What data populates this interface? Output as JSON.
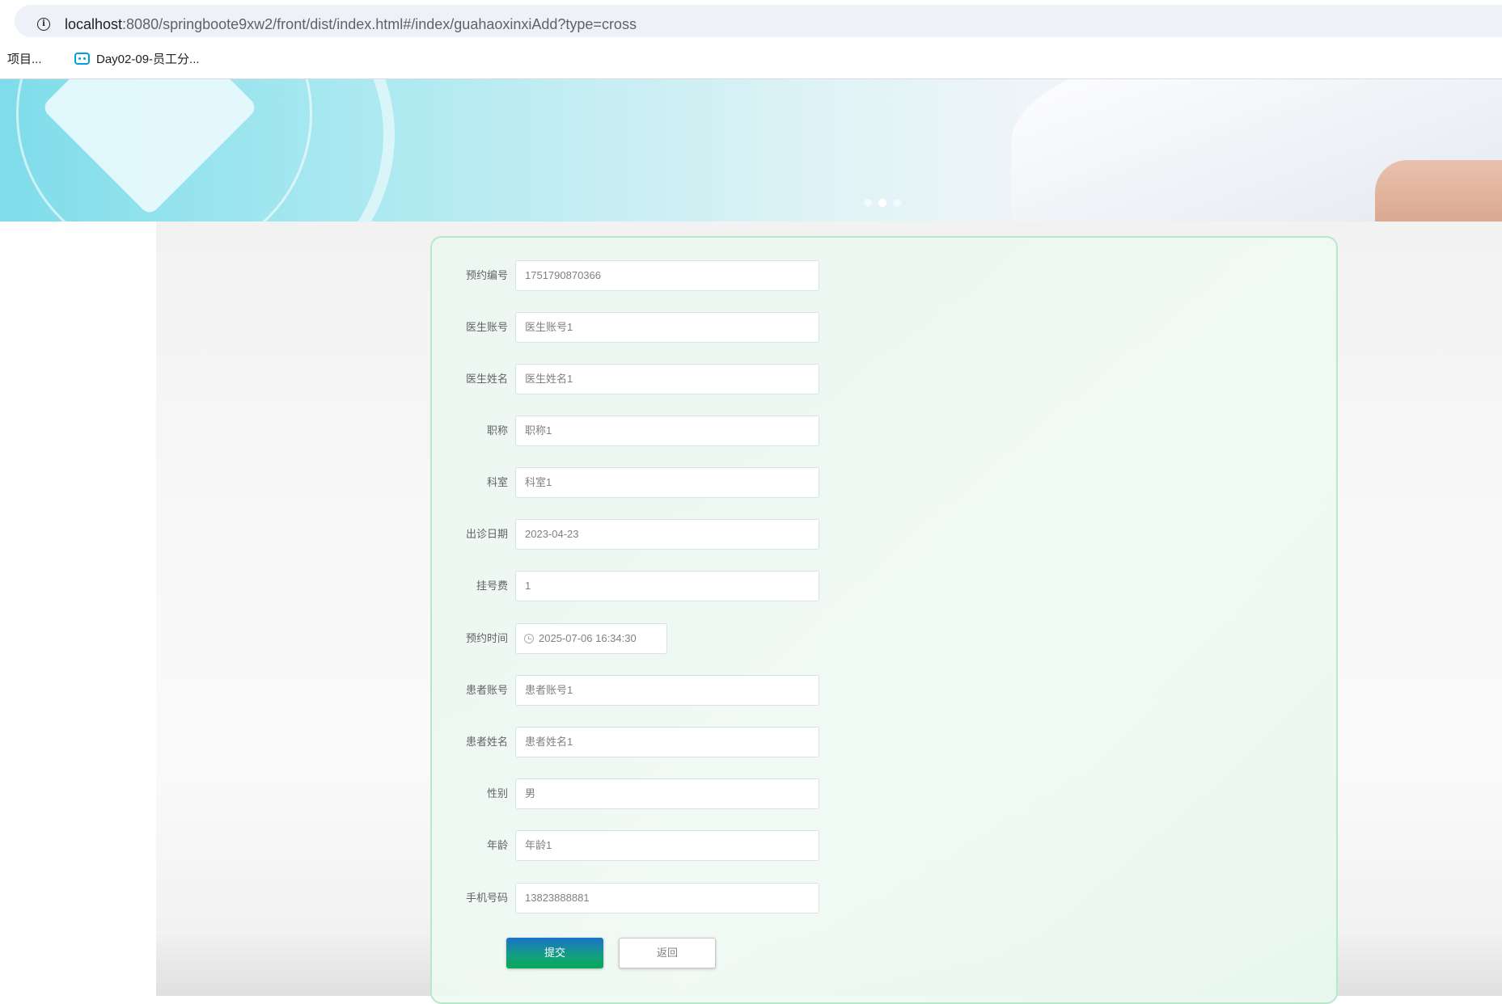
{
  "browser": {
    "url_host": "localhost",
    "url_rest": ":8080/springboote9xw2/front/dist/index.html#/index/guahaoxinxiAdd?type=cross",
    "bookmarks": [
      {
        "label": "】项目..."
      },
      {
        "label": "Day02-09-员工分..."
      }
    ]
  },
  "banner": {
    "carousel_total": 3,
    "carousel_active_index": 2
  },
  "form": {
    "fields": [
      {
        "label": "预约编号",
        "value": "1751790870366"
      },
      {
        "label": "医生账号",
        "value": "医生账号1"
      },
      {
        "label": "医生姓名",
        "value": "医生姓名1"
      },
      {
        "label": "职称",
        "value": "职称1"
      },
      {
        "label": "科室",
        "value": "科室1"
      },
      {
        "label": "出诊日期",
        "value": "2023-04-23"
      },
      {
        "label": "挂号费",
        "value": "1"
      },
      {
        "label": "预约时间",
        "value": "2025-07-06 16:34:30"
      },
      {
        "label": "患者账号",
        "value": "患者账号1"
      },
      {
        "label": "患者姓名",
        "value": "患者姓名1"
      },
      {
        "label": "性别",
        "value": "男"
      },
      {
        "label": "年龄",
        "value": "年龄1"
      },
      {
        "label": "手机号码",
        "value": "13823888881"
      }
    ],
    "submit_label": "提交",
    "back_label": "返回"
  },
  "colors": {
    "card_border": "#b7e8c8",
    "submit_gradient_top": "#1b72c9",
    "submit_gradient_bottom": "#07a85a"
  }
}
